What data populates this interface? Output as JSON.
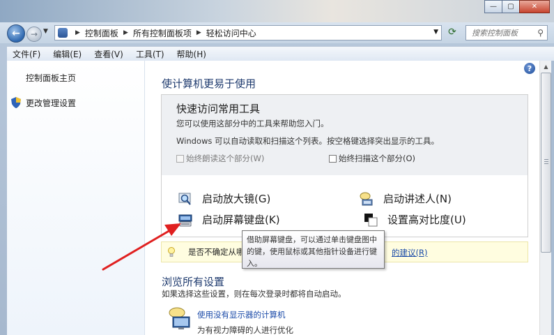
{
  "window": {
    "min_glyph": "—",
    "max_glyph": "▢",
    "close_glyph": "✕"
  },
  "nav": {
    "breadcrumbs": [
      "控制面板",
      "所有控制面板项",
      "轻松访问中心"
    ],
    "search_placeholder": "搜索控制面板"
  },
  "menu": [
    "文件(F)",
    "编辑(E)",
    "查看(V)",
    "工具(T)",
    "帮助(H)"
  ],
  "sidebar": {
    "items": [
      {
        "label": "控制面板主页"
      },
      {
        "label": "更改管理设置",
        "icon": "shield-icon"
      }
    ]
  },
  "main": {
    "title": "使计算机更易于使用",
    "quick_access": {
      "title": "快速访问常用工具",
      "desc1": "您可以使用这部分中的工具来帮助您入门。",
      "desc2": "Windows 可以自动读取和扫描这个列表。按空格键选择突出显示的工具。",
      "checkbox_read": "始终朗读这个部分(W)",
      "checkbox_scan": "始终扫描这个部分(O)",
      "tools": [
        {
          "label": "启动放大镜(G)",
          "icon": "magnifier-icon"
        },
        {
          "label": "启动讲述人(N)",
          "icon": "narrator-icon"
        },
        {
          "label": "启动屏幕键盘(K)",
          "icon": "keyboard-icon"
        },
        {
          "label": "设置高对比度(U)",
          "icon": "contrast-icon"
        }
      ]
    },
    "tip": {
      "text": "是否不确定从哪",
      "link": "的建议(R)"
    },
    "tooltip": "借助屏幕键盘，可以通过单击键盘图中的键，使用鼠标或其他指针设备进行键入。",
    "browse": {
      "title": "浏览所有设置",
      "desc": "如果选择这些设置，则在每次登录时都将自动启动。",
      "item_link": "使用没有显示器的计算机",
      "item_desc": "为有视力障碍的人进行优化"
    }
  },
  "colors": {
    "link": "#1a4aa8",
    "heading": "#1e3a6e",
    "annotation_arrow": "#e02020"
  }
}
